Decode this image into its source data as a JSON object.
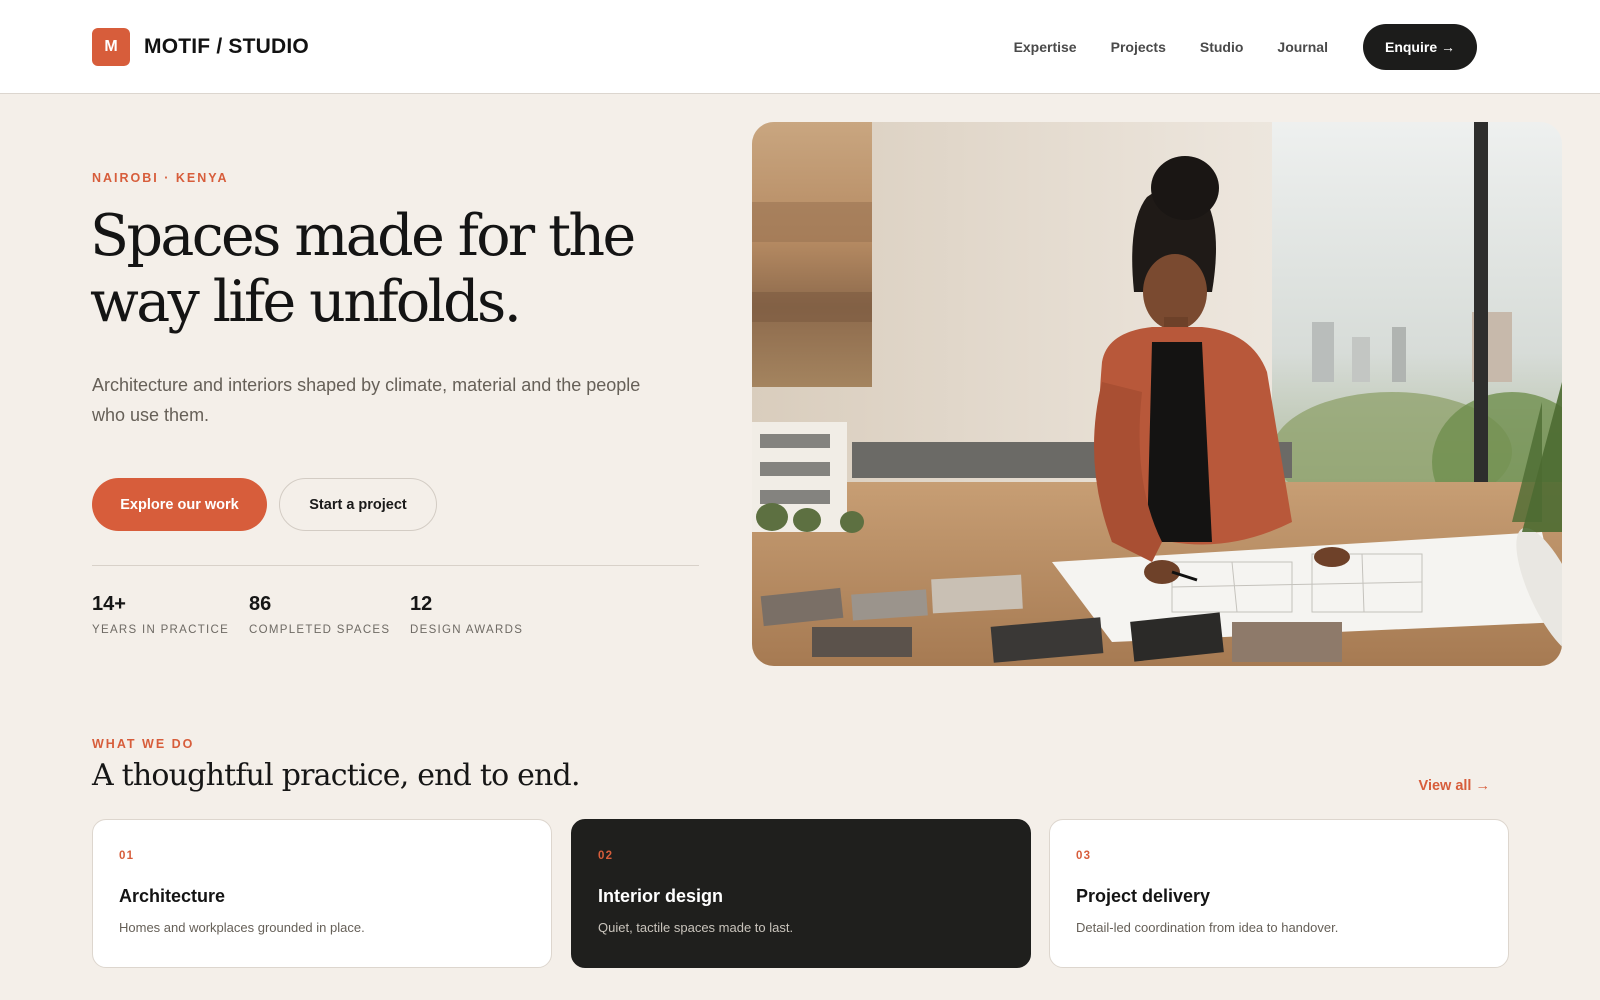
{
  "header": {
    "logo_letter": "M",
    "brand": "MOTIF / STUDIO",
    "nav": [
      "Expertise",
      "Projects",
      "Studio",
      "Journal"
    ],
    "cta": "Enquire →"
  },
  "hero": {
    "eyebrow": "NAIROBI · KENYA",
    "title": "Spaces made for the way life unfolds.",
    "subtitle": "Architecture and interiors shaped by climate, material and the people who use them.",
    "primary_button": "Explore our work",
    "secondary_button": "Start a project",
    "stats": [
      {
        "value": "14+",
        "label": "YEARS IN PRACTICE"
      },
      {
        "value": "86",
        "label": "COMPLETED SPACES"
      },
      {
        "value": "12",
        "label": "DESIGN AWARDS"
      }
    ],
    "image": "architect-at-drafting-table-photo"
  },
  "services": {
    "eyebrow": "WHAT WE DO",
    "title": "A thoughtful practice, end to end.",
    "view_all": "View all →",
    "cards": [
      {
        "number": "01",
        "title": "Architecture",
        "description": "Homes and workplaces grounded in place."
      },
      {
        "number": "02",
        "title": "Interior design",
        "description": "Quiet, tactile spaces made to last."
      },
      {
        "number": "03",
        "title": "Project delivery",
        "description": "Detail-led coordination from idea to handover."
      }
    ]
  },
  "colors": {
    "accent": "#d75d3b",
    "background": "#f4efe9",
    "dark": "#1c1c1b"
  }
}
